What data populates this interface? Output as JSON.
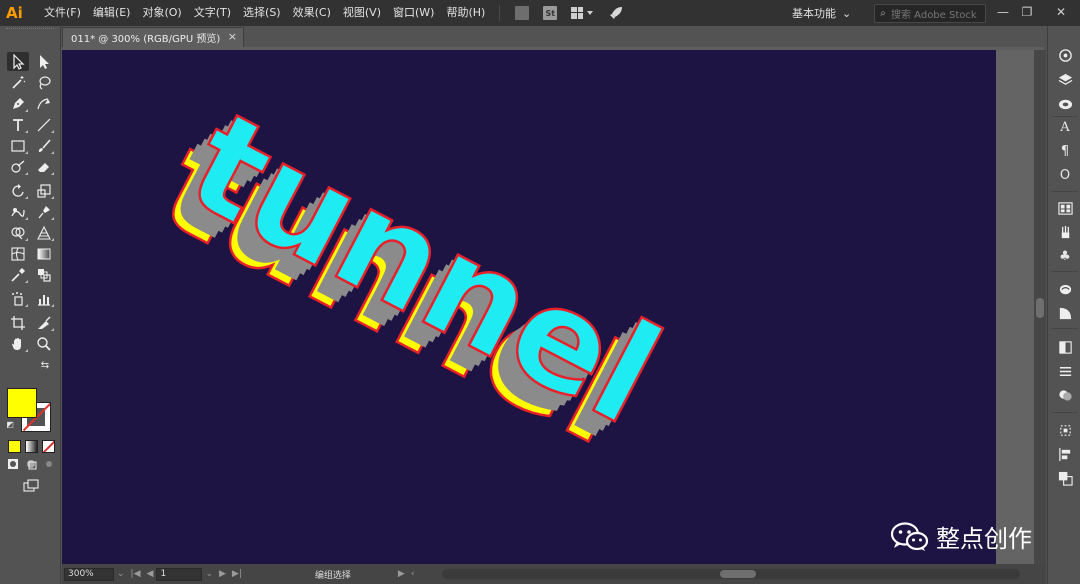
{
  "app": {
    "logo": "Ai"
  },
  "menu": {
    "items": [
      "文件(F)",
      "编辑(E)",
      "对象(O)",
      "文字(T)",
      "选择(S)",
      "效果(C)",
      "视图(V)",
      "窗口(W)",
      "帮助(H)"
    ],
    "stock_badge": "St"
  },
  "workspace": {
    "label": "基本功能",
    "chevron": "⌄"
  },
  "search": {
    "placeholder": "搜索 Adobe Stock"
  },
  "window_controls": {
    "minimize": "—",
    "restore": "❐",
    "close": "✕"
  },
  "document_tab": {
    "title": "011* @ 300% (RGB/GPU 预览)",
    "close": "×"
  },
  "artwork": {
    "text": "tunnel",
    "face_color": "#1fecf2",
    "side_color": "#8b8b8b",
    "end_color": "#ffff00",
    "outline_color": "#e8202a",
    "artboard_color": "#1d1444"
  },
  "swatches": {
    "fill": "#ffff00",
    "stroke": "#ffffff"
  },
  "status": {
    "zoom": "300%",
    "artboard_number": "1",
    "tool_label": "编组选择",
    "arrow_prev": "|◀",
    "arrow_left": "◀",
    "arrow_right": "▶",
    "arrow_next": "▶|",
    "status_arrow": "▶",
    "scroll_left": "‹"
  },
  "watermark": {
    "text": "整点创作"
  }
}
